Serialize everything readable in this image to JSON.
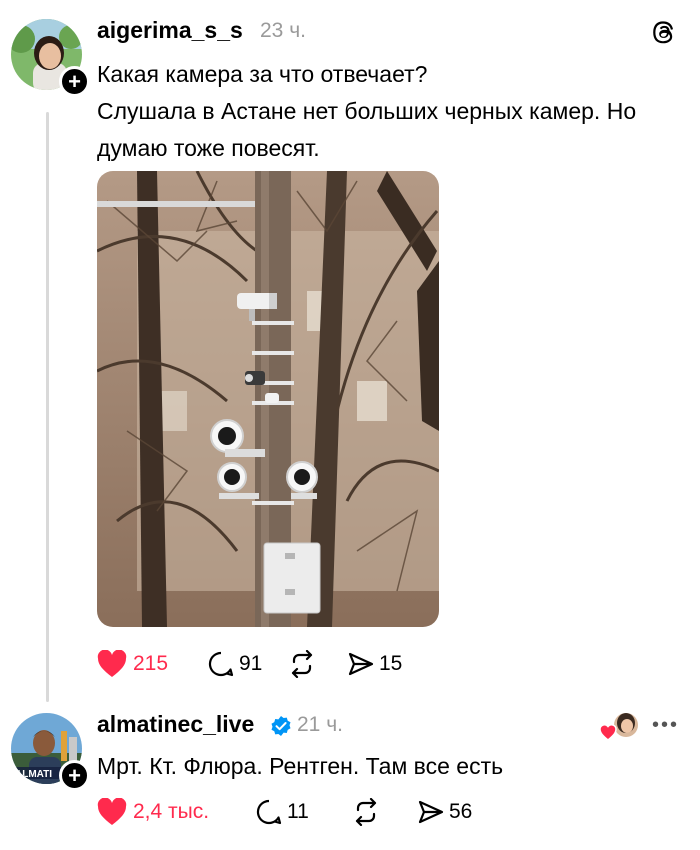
{
  "post": {
    "username": "aigerima_s_s",
    "time": "23 ч.",
    "text_line1": "Какая камера за что отвечает?",
    "text_line2": "Слушала в Астане нет больших черных камер. Но думаю тоже повесят.",
    "likes": "215",
    "comments": "91",
    "shares": "15",
    "icon_names": [
      "threads-logo-icon",
      "heart-icon",
      "comment-icon",
      "repost-icon",
      "share-icon",
      "follow-plus-icon"
    ]
  },
  "reply": {
    "username": "almatinec_live",
    "time": "21 ч.",
    "text": "Мрт. Кт. Флюра. Рентген. Там все есть",
    "avatar_text": "ALMATI",
    "likes": "2,4 тыс.",
    "comments": "11",
    "shares": "56",
    "icon_names": [
      "verified-icon",
      "liked-by-author-icon",
      "more-icon"
    ]
  },
  "colors": {
    "like_red": "#ff2a4d",
    "verified_blue": "#0095f6",
    "muted_gray": "#9a9a9a"
  }
}
